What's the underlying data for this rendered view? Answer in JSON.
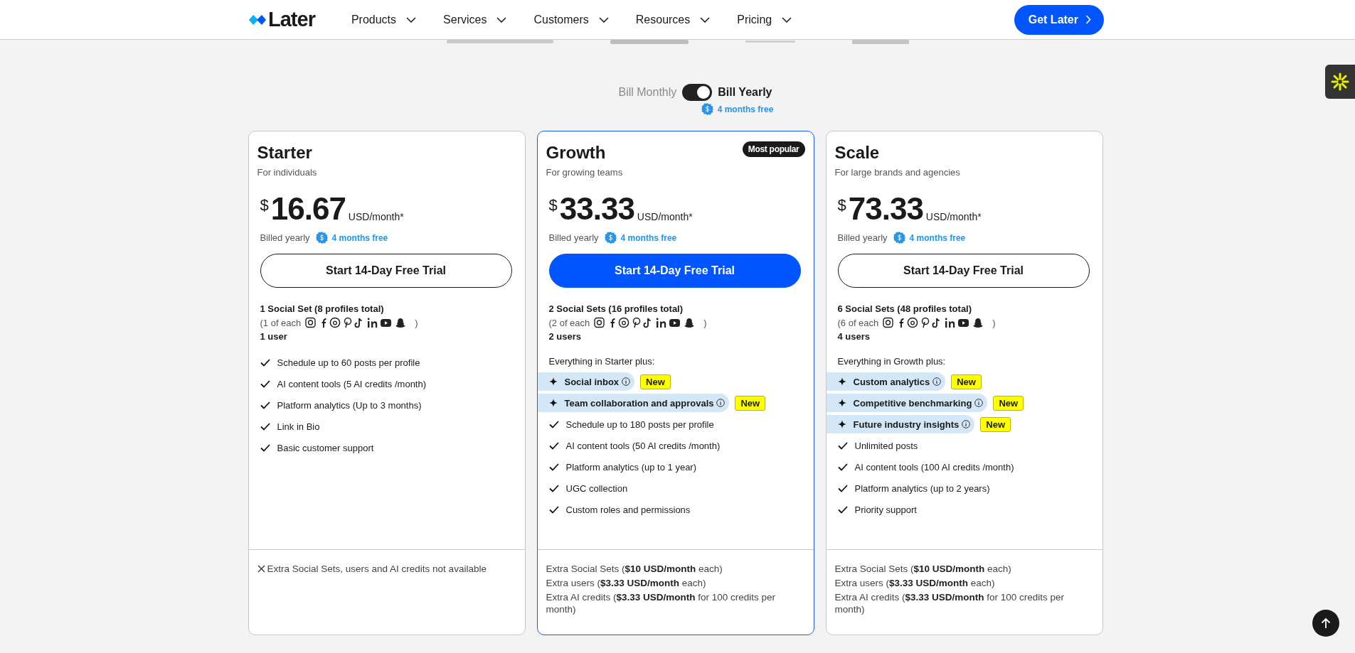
{
  "nav": {
    "logo": "Later",
    "items": [
      {
        "label": "Products"
      },
      {
        "label": "Services"
      },
      {
        "label": "Customers"
      },
      {
        "label": "Resources"
      },
      {
        "label": "Pricing"
      }
    ],
    "cta": "Get Later"
  },
  "billing": {
    "monthly_label": "Bill Monthly",
    "yearly_label": "Bill Yearly",
    "yearly": true,
    "promo": "4 months free"
  },
  "plans": [
    {
      "name": "Starter",
      "subtitle": "For individuals",
      "featured": false,
      "currency": "$",
      "price": "16.67",
      "unit": "USD/month*",
      "billed": "Billed yearly",
      "promo": "4 months free",
      "cta": "Start 14-Day Free Trial",
      "social_sets": "1 Social Set (8 profiles total)",
      "networks_note": "(1 of each",
      "networks_close": ")",
      "users": "1 user",
      "features": [
        {
          "kind": "check",
          "text": "Schedule up to 60 posts per profile"
        },
        {
          "kind": "check",
          "text": "AI content tools (5 AI credits /month)"
        },
        {
          "kind": "check",
          "text": "Platform analytics (Up to 3 months)"
        },
        {
          "kind": "check",
          "text": "Link in Bio"
        },
        {
          "kind": "check",
          "text": "Basic customer support"
        }
      ],
      "extras": [
        {
          "kind": "unavailable",
          "text": "Extra Social Sets, users and AI credits not available"
        }
      ]
    },
    {
      "name": "Growth",
      "subtitle": "For growing teams",
      "featured": true,
      "badge": "Most popular",
      "currency": "$",
      "price": "33.33",
      "unit": "USD/month*",
      "billed": "Billed yearly",
      "promo": "4 months free",
      "cta": "Start 14-Day Free Trial",
      "social_sets": "2 Social Sets (16 profiles total)",
      "networks_note": "(2 of each",
      "networks_close": ")",
      "users": "2 users",
      "intro": "Everything in Starter plus:",
      "features": [
        {
          "kind": "highlight",
          "text": "Social inbox",
          "badge": "New"
        },
        {
          "kind": "highlight",
          "text": "Team collaboration and approvals",
          "badge": "New"
        },
        {
          "kind": "check",
          "text": "Schedule up to 180 posts per profile"
        },
        {
          "kind": "check",
          "text": "AI content tools (50 AI credits /month)"
        },
        {
          "kind": "check",
          "text": "Platform analytics (up to 1 year)"
        },
        {
          "kind": "check",
          "text": "UGC collection"
        },
        {
          "kind": "check",
          "text": "Custom roles and permissions"
        }
      ],
      "extras": [
        {
          "kind": "plain",
          "text": "Extra Social Sets (**$10 USD/month** each)"
        },
        {
          "kind": "plain",
          "text": "Extra users (**$3.33 USD/month** each)"
        },
        {
          "kind": "plain",
          "text": "Extra AI credits (**$3.33 USD/month** for 100 credits per month)"
        }
      ]
    },
    {
      "name": "Scale",
      "subtitle": "For large brands and agencies",
      "featured": false,
      "currency": "$",
      "price": "73.33",
      "unit": "USD/month*",
      "billed": "Billed yearly",
      "promo": "4 months free",
      "cta": "Start 14-Day Free Trial",
      "social_sets": "6 Social Sets (48 profiles total)",
      "networks_note": "(6 of each",
      "networks_close": ")",
      "users": "4 users",
      "intro": "Everything in Growth plus:",
      "features": [
        {
          "kind": "highlight",
          "text": "Custom analytics",
          "badge": "New"
        },
        {
          "kind": "highlight",
          "text": "Competitive benchmarking",
          "badge": "New"
        },
        {
          "kind": "highlight",
          "text": "Future industry insights",
          "badge": "New"
        },
        {
          "kind": "check",
          "text": "Unlimited posts"
        },
        {
          "kind": "check",
          "text": "AI content tools (100 AI credits /month)"
        },
        {
          "kind": "check",
          "text": "Platform analytics (up to 2 years)"
        },
        {
          "kind": "check",
          "text": "Priority support"
        }
      ],
      "extras": [
        {
          "kind": "plain",
          "text": "Extra Social Sets (**$10 USD/month** each)"
        },
        {
          "kind": "plain",
          "text": "Extra users (**$3.33 USD/month** each)"
        },
        {
          "kind": "plain",
          "text": "Extra AI credits (**$3.33 USD/month** for 100 credits per month)"
        }
      ]
    }
  ]
}
